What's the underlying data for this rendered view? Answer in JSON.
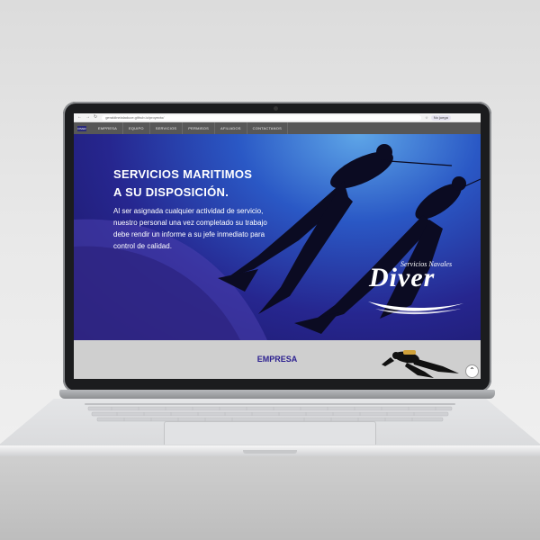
{
  "browser": {
    "url": "geraldinelaladuce.github.io/proyecto/",
    "profile_label": "No juega"
  },
  "nav": {
    "logo_text": "DIVER",
    "items": [
      "EMPRESA",
      "EQUIPO",
      "SERVICIOS",
      "PERMISOS",
      "AFILIADOS",
      "CONTACTANOS"
    ]
  },
  "hero": {
    "title_line1": "SERVICIOS MARITIMOS",
    "title_line2": "A SU DISPOSICIÓN.",
    "text_line1": "Al ser asignada cualquier actividad de servicio,",
    "text_line2": "nuestro personal una vez completado su trabajo",
    "text_line3": "debe rendir un informe a su jefe inmediato para",
    "text_line4": "control de calidad."
  },
  "brand": {
    "subtitle": "Servicios Navales",
    "name": "Diver"
  },
  "section": {
    "title": "EMPRESA"
  },
  "icons": {
    "back": "back-arrow-icon",
    "forward": "forward-arrow-icon",
    "reload": "reload-icon",
    "to_top": "chevron-up-icon"
  },
  "to_top_glyph": "⌃",
  "colors": {
    "nav_bg": "#575757",
    "section_title": "#2b1f8f",
    "hero_deep": "#1b1560",
    "hero_light": "#5ea6e8"
  }
}
